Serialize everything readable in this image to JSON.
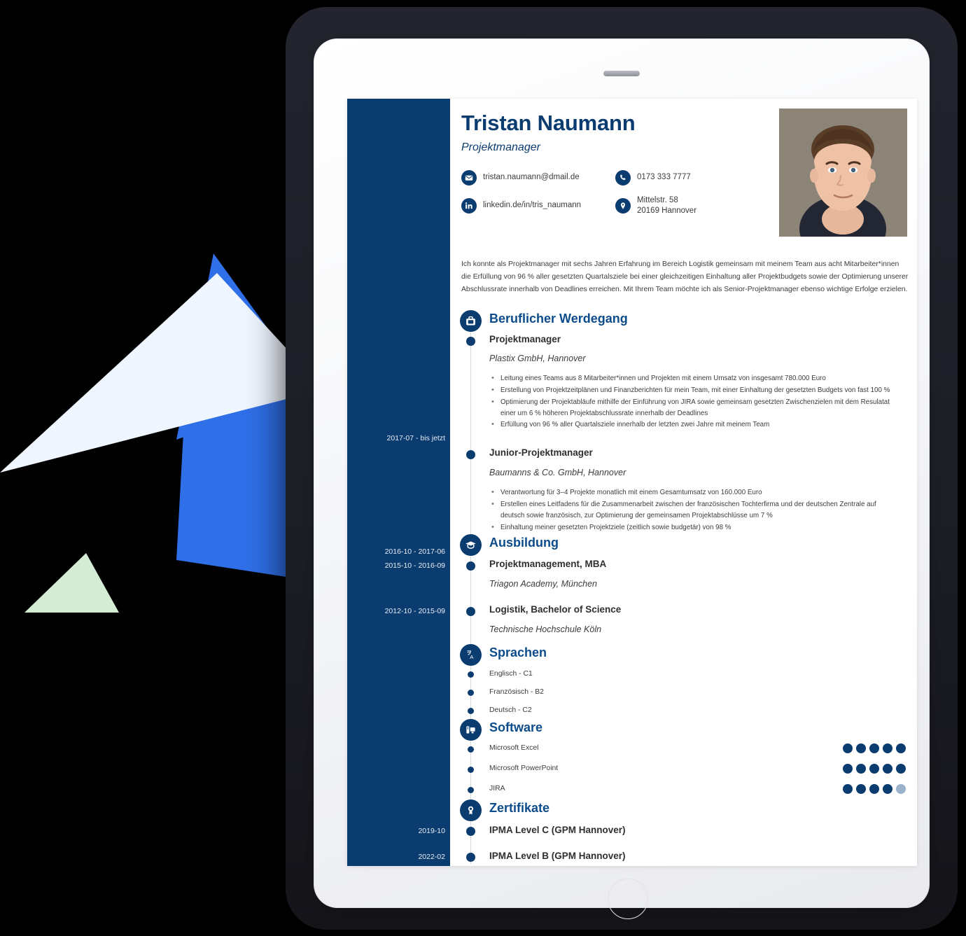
{
  "device": {
    "kind": "tablet-mockup",
    "camera": "camera-dot",
    "home_button": "home-button"
  },
  "theme": {
    "navy": "#0b3c70",
    "heading_blue": "#0d4c8b",
    "accent_blue": "#2f6fe8",
    "pale_blue": "#f0f6ff",
    "mint": "#d3ecd3",
    "dot_off": "#9bb2cb",
    "frame_dark": "#23242e"
  },
  "resume": {
    "name": "Tristan Naumann",
    "job_title": "Projektmanager",
    "photo_alt": "portrait-photo",
    "contacts": [
      {
        "icon": "email-icon",
        "lines": [
          "tristan.naumann@dmail.de"
        ]
      },
      {
        "icon": "linkedin-icon",
        "lines": [
          "linkedin.de/in/tris_naumann"
        ]
      },
      {
        "icon": "phone-icon",
        "lines": [
          "0173 333 7777"
        ]
      },
      {
        "icon": "location-icon",
        "lines": [
          "Mittelstr. 58",
          "20169 Hannover"
        ]
      }
    ],
    "summary": "Ich konnte als Projektmanager mit sechs Jahren Erfahrung im Bereich Logistik gemeinsam mit meinem Team aus acht Mitarbeiter*innen die Erfüllung von 96 % aller gesetzten Quartalsziele bei einer gleichzeitigen Einhaltung aller Projektbudgets sowie der Optimierung unserer Abschlussrate innerhalb von Deadlines erreichen. Mit Ihrem Team möchte ich als Senior-Projektmanager ebenso wichtige Erfolge erzielen.",
    "sections": {
      "experience": {
        "title": "Beruflicher Werdegang",
        "icon": "briefcase-icon",
        "items": [
          {
            "date": "2017-07  - bis jetzt",
            "role": "Projektmanager",
            "org": "Plastix GmbH, Hannover",
            "bullets": [
              "Leitung eines Teams aus 8 Mitarbeiter*innen und Projekten mit einem Umsatz von insgesamt 780.000 Euro",
              "Erstellung von Projektzeitplänen und Finanzberichten für mein Team, mit einer Einhaltung der gesetzten Budgets von fast 100 %",
              "Optimierung der Projektabläufe mithilfe der Einführung von JIRA sowie gemeinsam gesetzten Zwischenzielen mit dem Resulatat einer um 6 % höheren Projektabschlussrate innerhalb der Deadlines",
              "Erfüllung von 96 % aller Quartalsziele innerhalb der letzten zwei Jahre mit meinem Team"
            ]
          },
          {
            "date": "2016-10  - 2017-06",
            "role": "Junior-Projektmanager",
            "org": "Baumanns & Co. GmbH, Hannover",
            "bullets": [
              "Verantwortung für 3–4 Projekte monatlich mit einem Gesamtumsatz von 160.000 Euro",
              "Erstellen eines Leitfadens für die Zusammenarbeit zwischen der französischen Tochterfirma und der deutschen Zentrale auf deutsch sowie französisch, zur Optimierung der gemeinsamen Projektabschlüsse um 7 %",
              "Einhaltung meiner gesetzten Projektziele (zeitlich sowie budgetär) von 98 %"
            ]
          }
        ]
      },
      "education": {
        "title": "Ausbildung",
        "icon": "graduation-cap-icon",
        "items": [
          {
            "date": "2015-10  - 2016-09",
            "role": "Projektmanagement, MBA",
            "org": "Triagon Academy, München"
          },
          {
            "date": "2012-10  - 2015-09",
            "role": "Logistik, Bachelor of Science",
            "org": "Technische Hochschule Köln"
          }
        ]
      },
      "languages": {
        "title": "Sprachen",
        "icon": "translate-icon",
        "items": [
          {
            "label": "Englisch - C1"
          },
          {
            "label": "Französisch - B2"
          },
          {
            "label": "Deutsch - C2"
          }
        ]
      },
      "software": {
        "title": "Software",
        "icon": "computer-icon",
        "max_rating": 5,
        "items": [
          {
            "label": "Microsoft Excel",
            "rating": 5
          },
          {
            "label": "Microsoft PowerPoint",
            "rating": 5
          },
          {
            "label": "JIRA",
            "rating": 4
          }
        ]
      },
      "certificates": {
        "title": "Zertifikate",
        "icon": "award-icon",
        "items": [
          {
            "date": "2019-10",
            "label": "IPMA Level C (GPM Hannover)"
          },
          {
            "date": "2022-02",
            "label": "IPMA Level B (GPM Hannover)"
          }
        ]
      }
    }
  }
}
